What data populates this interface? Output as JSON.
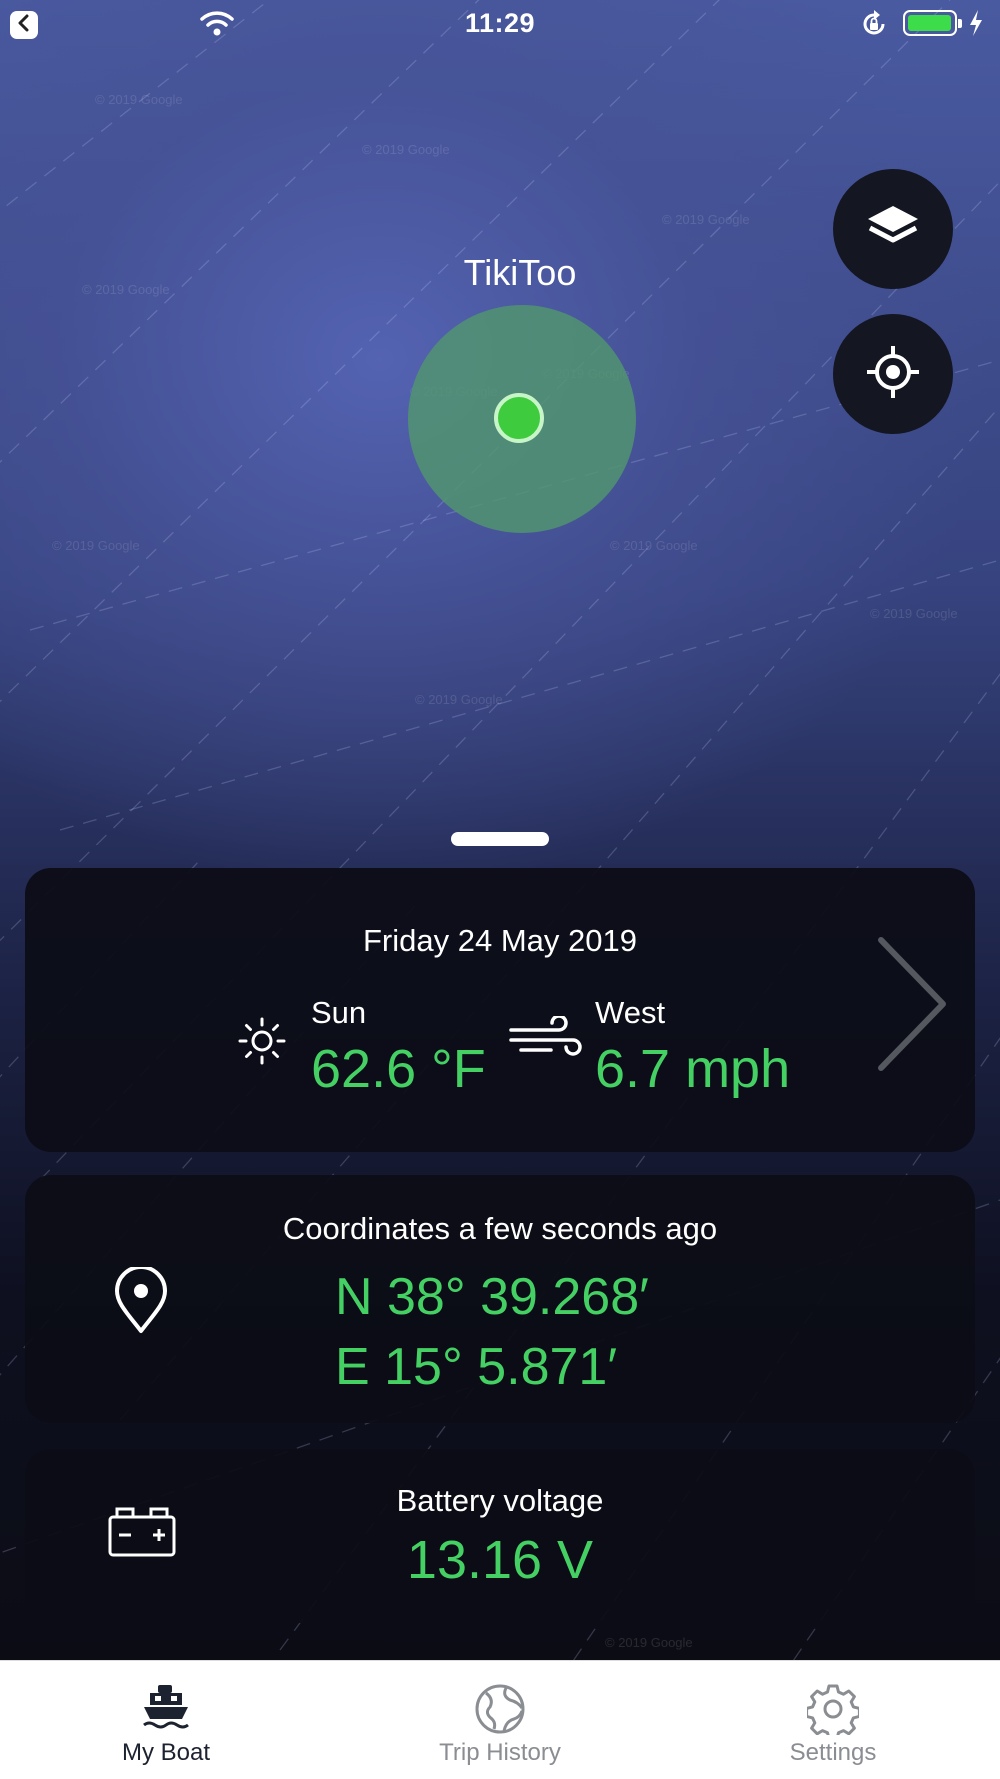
{
  "status_bar": {
    "time": "11:29"
  },
  "map": {
    "boat_name": "TikiToo",
    "watermark": "© 2019 Google",
    "layers_icon": "layers-icon",
    "locate_icon": "crosshair-icon"
  },
  "weather": {
    "date": "Friday 24 May 2019",
    "condition": "Sun",
    "temperature": "62.6 °F",
    "wind_direction": "West",
    "wind_speed": "6.7 mph",
    "icons": [
      "sun-icon",
      "wind-icon",
      "chevron-right-icon"
    ]
  },
  "coordinates": {
    "title": "Coordinates a few seconds ago",
    "latitude": "N 38° 39.268′",
    "longitude": "E 15° 5.871′",
    "icon": "location-pin-icon"
  },
  "battery": {
    "title": "Battery voltage",
    "voltage": "13.16 V",
    "icon": "car-battery-icon"
  },
  "tabs": [
    {
      "label": "My Boat",
      "icon": "boat-icon",
      "active": true
    },
    {
      "label": "Trip History",
      "icon": "globe-icon",
      "active": false
    },
    {
      "label": "Settings",
      "icon": "gear-icon",
      "active": false
    }
  ],
  "colors": {
    "accent_green": "#45d064",
    "card_bg": "#0c0d16",
    "tab_active": "#1c2230",
    "tab_inactive": "#8a8d92"
  }
}
